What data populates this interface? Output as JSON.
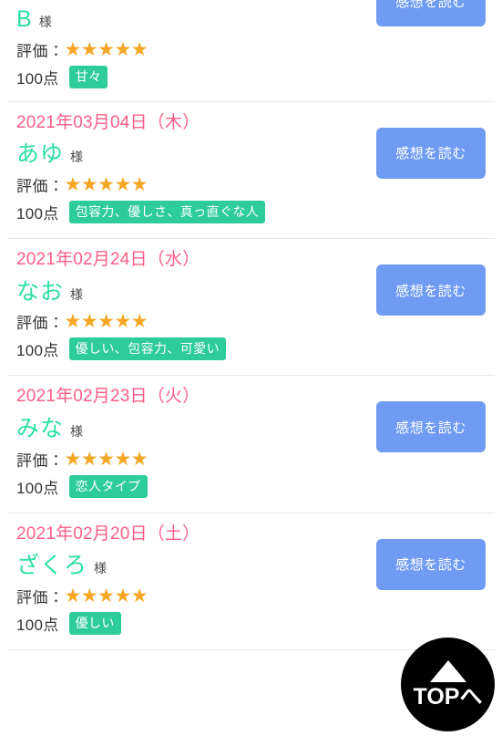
{
  "page": {
    "background_color": "#ffffff",
    "date_color": "#ff5e87",
    "name_color": "#2be0a3",
    "star_color": "#f5a623",
    "tag_color": "#2ecc9b",
    "button_color": "#6f9bf3"
  },
  "labels": {
    "rating_label": "評価：",
    "honorific": "様",
    "stars_filled": "★★★★★",
    "read_button": "感想を読む"
  },
  "back_to_top": {
    "label": "TOPへ",
    "icon": "triangle-up-icon"
  },
  "reviews": [
    {
      "date": "",
      "name": "B",
      "honorific": "様",
      "rating_label": "評価：",
      "stars": "★★★★★",
      "stars_count": 5,
      "score": "100点",
      "tag": "甘々",
      "button_label": "感想を読む",
      "clipped": true
    },
    {
      "date": "2021年03月04日（木）",
      "name": "あゆ",
      "honorific": "様",
      "rating_label": "評価：",
      "stars": "★★★★★",
      "stars_count": 5,
      "score": "100点",
      "tag": "包容力、優しさ、真っ直ぐな人",
      "button_label": "感想を読む",
      "clipped": false
    },
    {
      "date": "2021年02月24日（水）",
      "name": "なお",
      "honorific": "様",
      "rating_label": "評価：",
      "stars": "★★★★★",
      "stars_count": 5,
      "score": "100点",
      "tag": "優しい、包容力、可愛い",
      "button_label": "感想を読む",
      "clipped": false
    },
    {
      "date": "2021年02月23日（火）",
      "name": "みな",
      "honorific": "様",
      "rating_label": "評価：",
      "stars": "★★★★★",
      "stars_count": 5,
      "score": "100点",
      "tag": "恋人タイプ",
      "button_label": "感想を読む",
      "clipped": false
    },
    {
      "date": "2021年02月20日（土）",
      "name": "ざくろ",
      "honorific": "様",
      "rating_label": "評価：",
      "stars": "★★★★★",
      "stars_count": 5,
      "score": "100点",
      "tag": "優しい",
      "button_label": "感想を読む",
      "clipped": false
    }
  ]
}
